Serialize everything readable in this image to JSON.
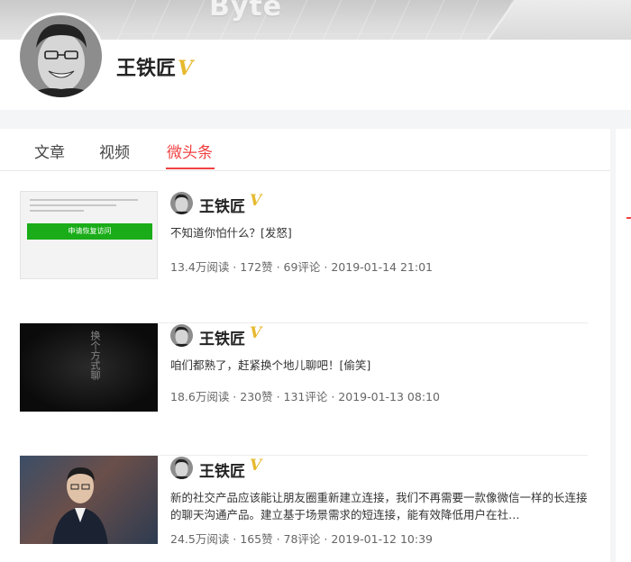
{
  "banner": {
    "brand_text": "Byte"
  },
  "profile": {
    "name": "王铁匠",
    "verified_mark": "V"
  },
  "tabs": [
    {
      "label": "文章",
      "active": false
    },
    {
      "label": "视频",
      "active": false
    },
    {
      "label": "微头条",
      "active": true
    }
  ],
  "feed": [
    {
      "author": "王铁匠",
      "verified_mark": "V",
      "content": "不知道你怕什么？[发怒]",
      "stats": "13.4万阅读 · 172赞 · 69评论 · 2019-01-14 21:01",
      "thumb_button": "申请恢复访问"
    },
    {
      "author": "王铁匠",
      "verified_mark": "V",
      "content": "咱们都熟了，赶紧换个地儿聊吧！[偷笑]",
      "stats": "18.6万阅读 · 230赞 · 131评论 · 2019-01-13 08:10",
      "thumb_text": "换个方式聊"
    },
    {
      "author": "王铁匠",
      "verified_mark": "V",
      "content": "新的社交产品应该能让朋友圈重新建立连接，我们不再需要一款像微信一样的长连接的聊天沟通产品。建立基于场景需求的短连接，能有效降低用户在社…",
      "stats": "24.5万阅读 · 165赞 · 78评论 · 2019-01-12 10:39"
    }
  ],
  "colors": {
    "accent": "#f04142",
    "verified": "#e6b92f",
    "wechat_green": "#1aad19"
  }
}
